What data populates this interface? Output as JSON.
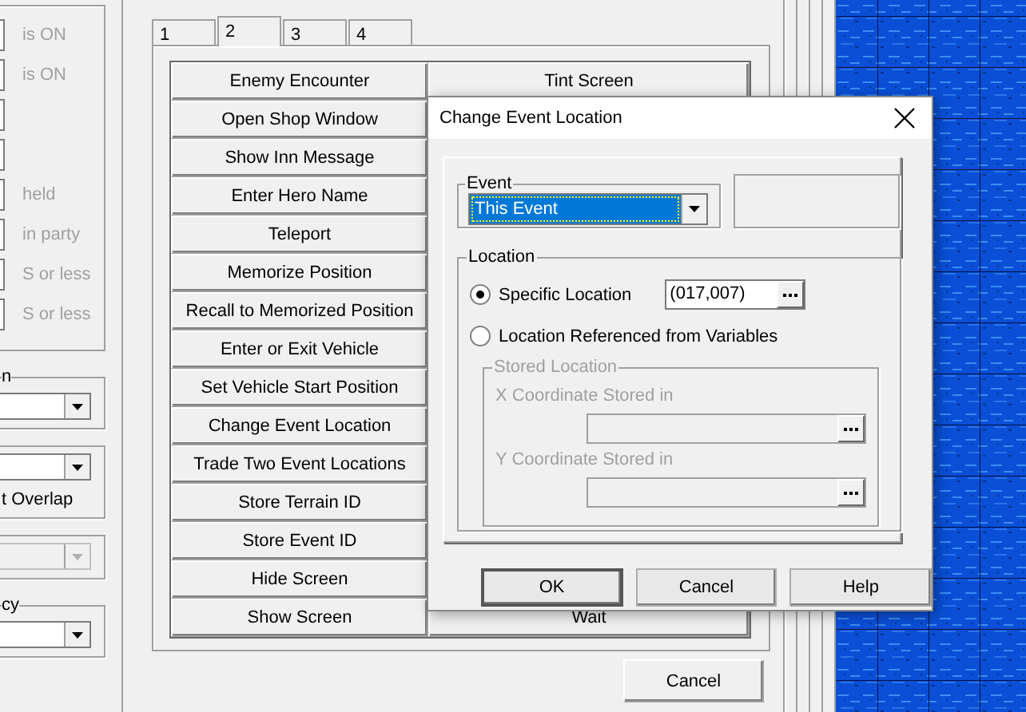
{
  "left_panel": {
    "conditions_disabled": true,
    "rows": [
      {
        "kind": "labeled",
        "label": "is ON"
      },
      {
        "kind": "labeled",
        "label": "is ON"
      },
      {
        "kind": "blank"
      },
      {
        "kind": "blank"
      },
      {
        "kind": "labeled",
        "label": "held"
      },
      {
        "kind": "labeled",
        "label": "in party"
      },
      {
        "kind": "labeled",
        "label": "S or less"
      },
      {
        "kind": "labeled",
        "label": "S or less"
      }
    ],
    "groups": [
      {
        "legend": "n",
        "dropdown_disabled": false
      },
      {
        "dropdown_disabled": false,
        "caption": "t Overlap"
      },
      {
        "dropdown_disabled": true
      },
      {
        "legend": "cy",
        "dropdown_disabled": false
      }
    ]
  },
  "command_window": {
    "tabs": [
      {
        "label": "1",
        "selected": false
      },
      {
        "label": "2",
        "selected": true
      },
      {
        "label": "3",
        "selected": false
      },
      {
        "label": "4",
        "selected": false
      }
    ],
    "left_buttons": [
      "Enemy Encounter",
      "Open Shop Window",
      "Show Inn Message",
      "Enter Hero Name",
      "Teleport",
      "Memorize Position",
      "Recall to Memorized Position",
      "Enter or Exit Vehicle",
      "Set Vehicle Start Position",
      "Change Event Location",
      "Trade Two Event Locations",
      "Store Terrain ID",
      "Store Event ID",
      "Hide Screen",
      "Show Screen"
    ],
    "right_column": {
      "top": "Tint Screen",
      "bottom": "Wait"
    },
    "cancel": "Cancel"
  },
  "dialog": {
    "title": "Change Event Location",
    "event": {
      "legend": "Event",
      "value": "This Event"
    },
    "location": {
      "legend": "Location",
      "options": [
        {
          "label": "Specific Location",
          "selected": true
        },
        {
          "label": "Location Referenced from Variables",
          "selected": false
        }
      ],
      "specific_value": "(017,007)",
      "stored": {
        "legend": "Stored Location",
        "disabled": true,
        "fields": [
          {
            "label": "X Coordinate Stored in"
          },
          {
            "label": "Y Coordinate Stored in"
          }
        ]
      }
    },
    "buttons": [
      "OK",
      "Cancel",
      "Help"
    ]
  }
}
